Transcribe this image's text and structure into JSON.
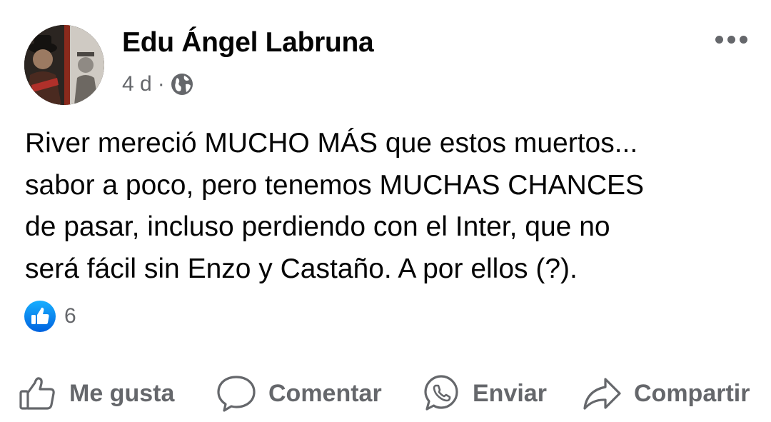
{
  "post": {
    "author_name": "Edu Ángel Labruna",
    "timestamp": "4 d",
    "separator": "·",
    "audience_icon": "globe-icon",
    "more_icon": "more-horizontal-icon",
    "text_lines": [
      "River mereció MUCHO MÁS que estos muertos...",
      "sabor a poco, pero tenemos MUCHAS CHANCES",
      "de pasar, incluso perdiendo con el Inter, que no",
      "será fácil sin Enzo y Castaño. A por ellos (?)."
    ],
    "reactions": {
      "icon": "like-reaction-icon",
      "count": "6"
    }
  },
  "actions": {
    "like_label": "Me gusta",
    "comment_label": "Comentar",
    "send_label": "Enviar",
    "share_label": "Compartir"
  },
  "colors": {
    "text_primary": "#050505",
    "text_secondary": "#65676b",
    "like_blue": "#1877f2"
  }
}
